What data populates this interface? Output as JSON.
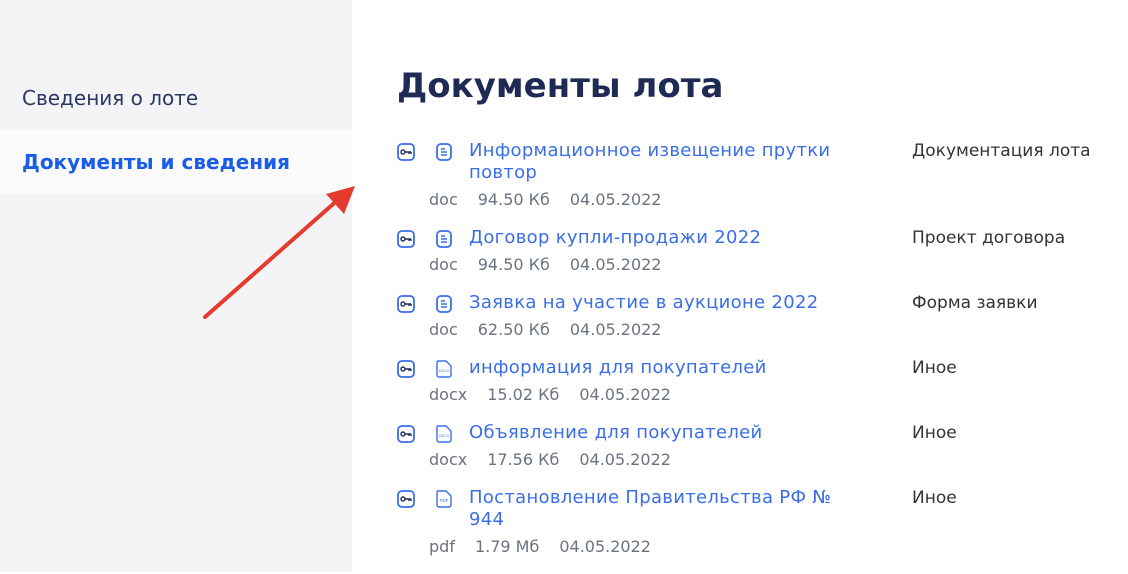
{
  "sidebar": {
    "items": [
      {
        "label": "Сведения о лоте"
      },
      {
        "label": "Документы и сведения"
      }
    ]
  },
  "main": {
    "title": "Документы лота",
    "documents": [
      {
        "name": "Информационное извещение прутки повтор",
        "ext": "doc",
        "size": "94.50 Кб",
        "date": "04.05.2022",
        "category": "Документация лота",
        "icon": "doc-icon"
      },
      {
        "name": "Договор купли-продажи 2022",
        "ext": "doc",
        "size": "94.50 Кб",
        "date": "04.05.2022",
        "category": "Проект договора",
        "icon": "doc-icon"
      },
      {
        "name": "Заявка на участие в аукционе 2022",
        "ext": "doc",
        "size": "62.50 Кб",
        "date": "04.05.2022",
        "category": "Форма заявки",
        "icon": "doc-icon"
      },
      {
        "name": "информация для покупателей",
        "ext": "docx",
        "size": "15.02 Кб",
        "date": "04.05.2022",
        "category": "Иное",
        "icon": "docx-icon"
      },
      {
        "name": "Объявление для покупателей",
        "ext": "docx",
        "size": "17.56 Кб",
        "date": "04.05.2022",
        "category": "Иное",
        "icon": "docx-icon"
      },
      {
        "name": "Постановление Правительства РФ № 944",
        "ext": "pdf",
        "size": "1.79 Мб",
        "date": "04.05.2022",
        "category": "Иное",
        "icon": "pdf-icon"
      }
    ]
  },
  "colors": {
    "accent": "#3a6ee8",
    "arrow": "#e53b2f"
  }
}
